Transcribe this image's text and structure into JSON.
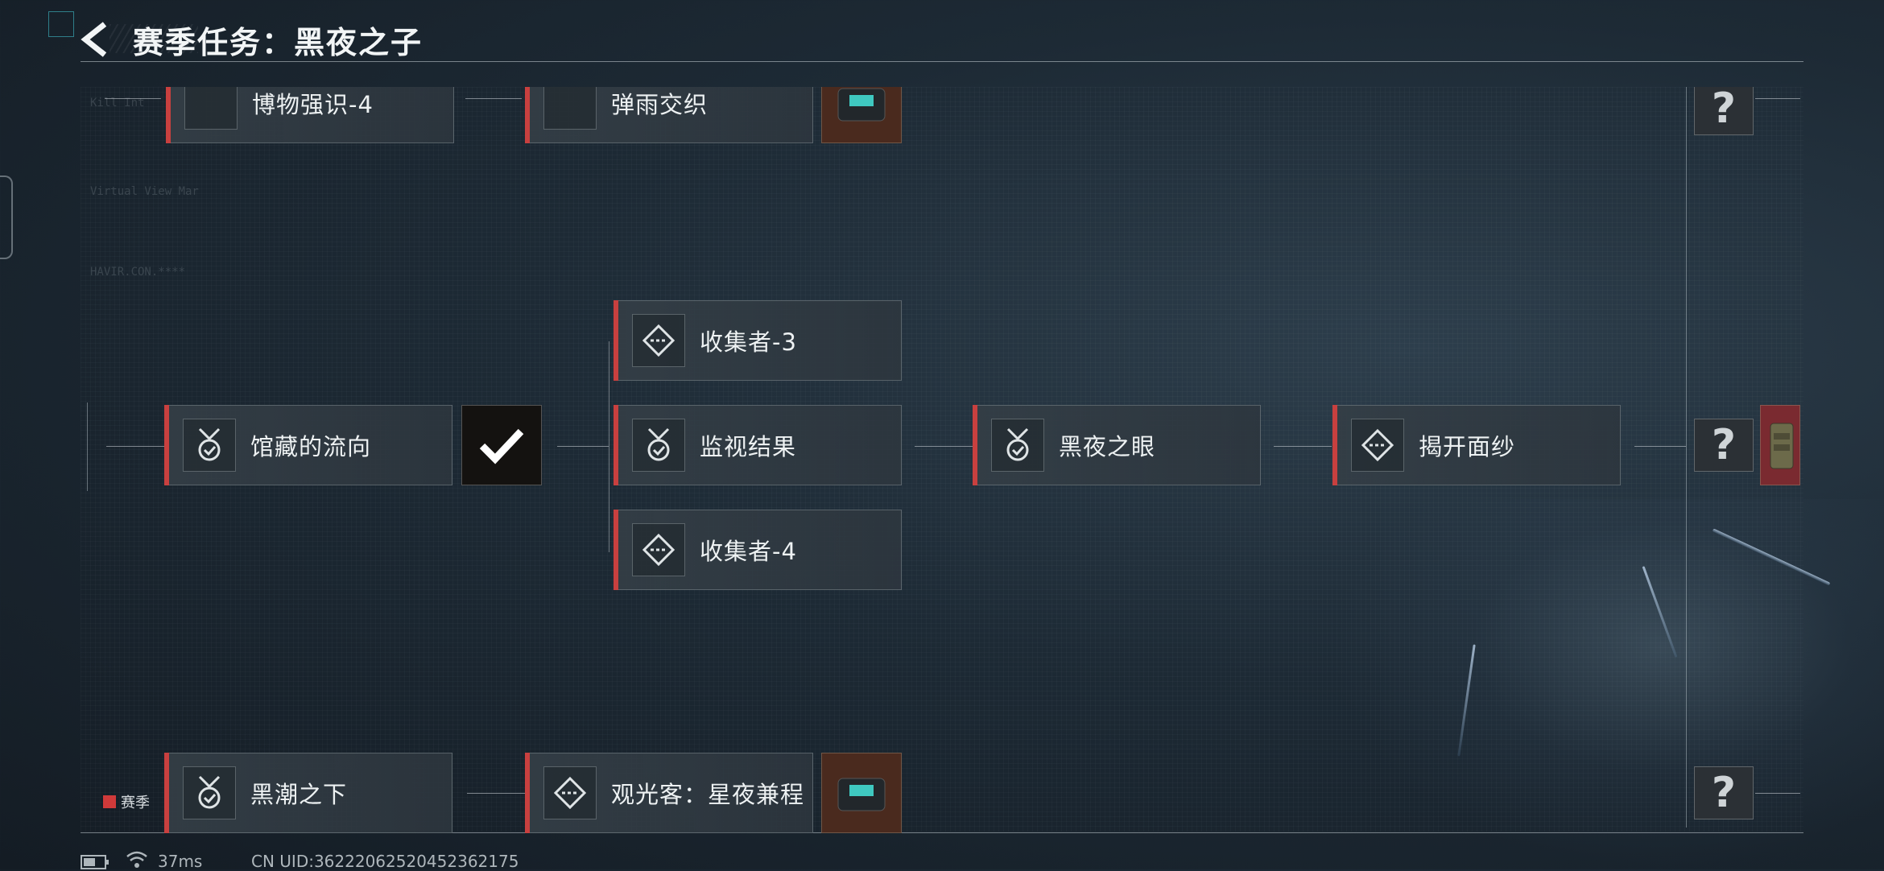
{
  "header": {
    "title": "赛季任务：黑夜之子"
  },
  "tasks": {
    "t_top1": {
      "label": "博物强识-4",
      "icon": "medal-icon"
    },
    "t_top2": {
      "label": "弹雨交织",
      "icon": "diamond-target-icon"
    },
    "t_mid_left": {
      "label": "馆藏的流向",
      "icon": "medal-icon"
    },
    "t_col_a": {
      "label": "收集者-3",
      "icon": "diamond-target-icon"
    },
    "t_col_b": {
      "label": "监视结果",
      "icon": "medal-icon"
    },
    "t_col_c": {
      "label": "收集者-4",
      "icon": "diamond-target-icon"
    },
    "t_eye": {
      "label": "黑夜之眼",
      "icon": "medal-icon"
    },
    "t_veil": {
      "label": "揭开面纱",
      "icon": "diamond-target-icon"
    },
    "t_bot1": {
      "label": "黑潮之下",
      "icon": "medal-icon"
    },
    "t_bot2": {
      "label": "观光客：星夜兼程",
      "icon": "diamond-target-icon"
    }
  },
  "unknown_glyph": "?",
  "season_tag": "赛季",
  "status_bar": {
    "ping": "37ms",
    "uid": "CN UID:36222062520452362175"
  },
  "colors": {
    "accent_red": "#c8403f",
    "line": "#c8d2d7",
    "bg": "#1d2a35"
  }
}
